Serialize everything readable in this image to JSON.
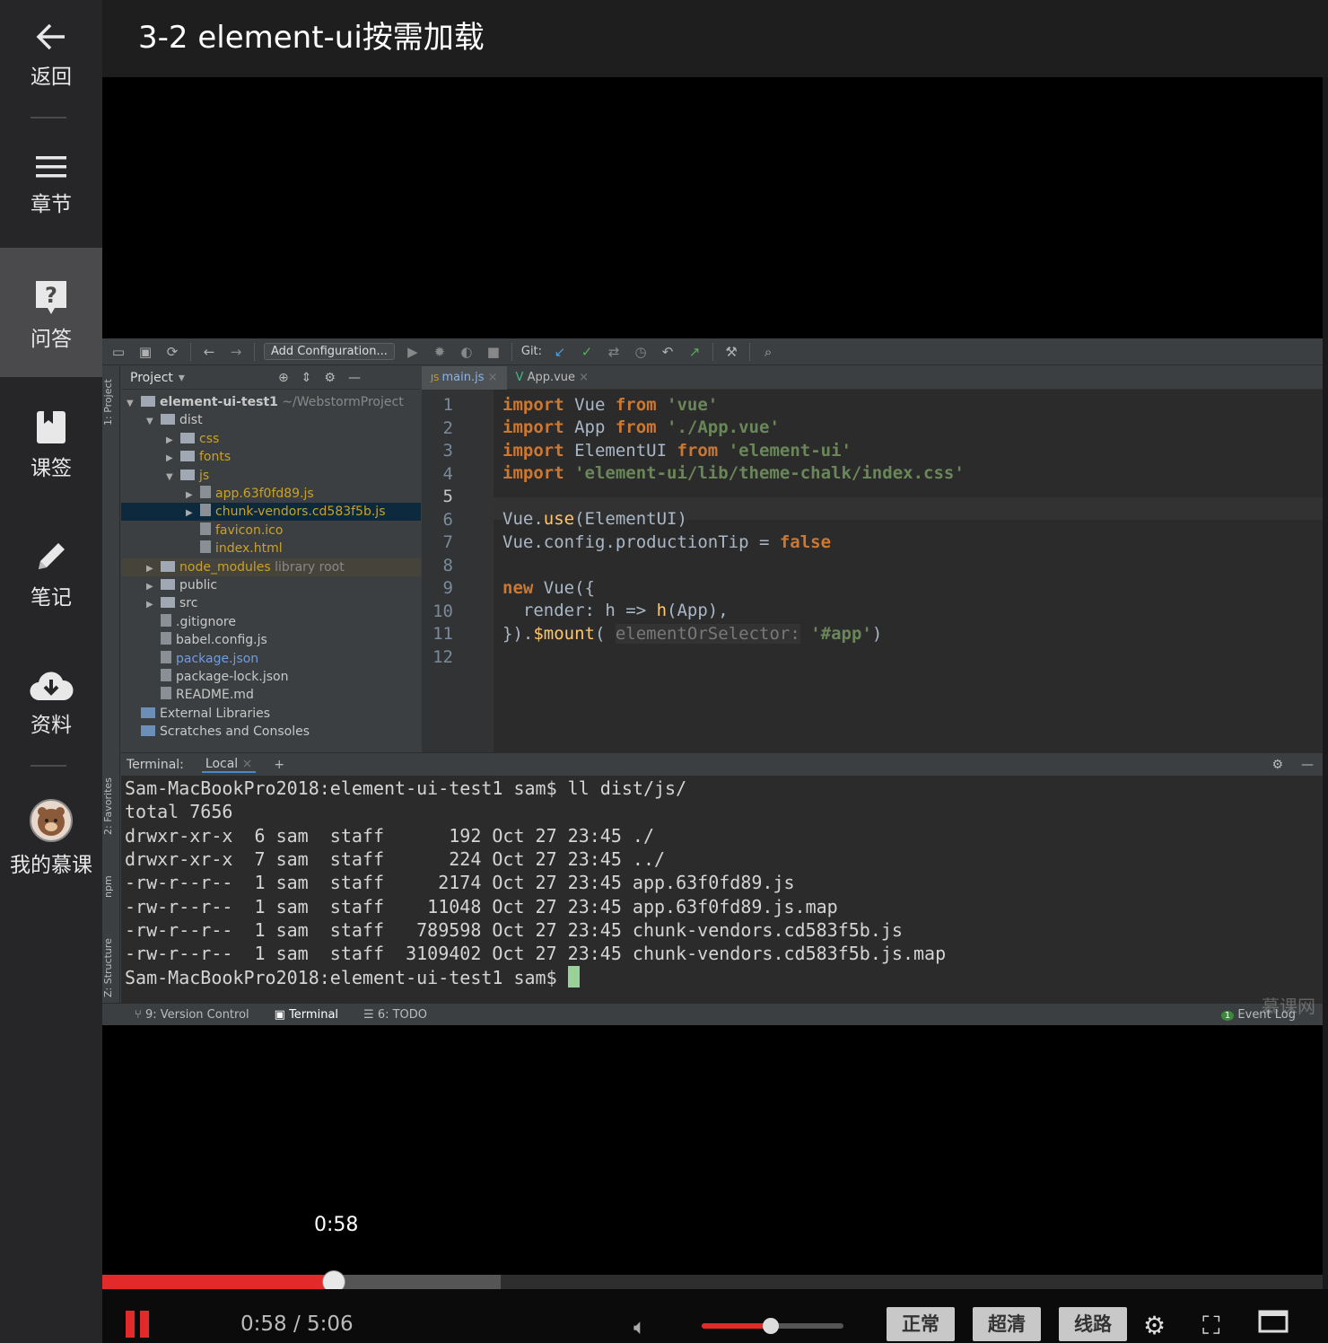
{
  "sidebar": {
    "items": [
      {
        "label": "返回",
        "icon": "back-arrow-icon"
      },
      {
        "label": "章节",
        "icon": "menu-icon"
      },
      {
        "label": "问答",
        "icon": "question-icon"
      },
      {
        "label": "课签",
        "icon": "bookmark-icon"
      },
      {
        "label": "笔记",
        "icon": "pencil-icon"
      },
      {
        "label": "资料",
        "icon": "cloud-download-icon"
      },
      {
        "label": "我的慕课",
        "icon": "avatar"
      }
    ]
  },
  "header": {
    "title": "3-2 element-ui按需加载"
  },
  "ide": {
    "toolbar": {
      "add_config": "Add Configuration...",
      "git_label": "Git:"
    },
    "vtabs": {
      "project": "1: Project",
      "favorites": "2: Favorites",
      "npm": "npm",
      "structure": "Z: Structure"
    },
    "project": {
      "header": "Project",
      "tree": [
        {
          "name": "element-ui-test1",
          "suffix": " ~/WebstormProject",
          "bold": true
        },
        {
          "name": "dist"
        },
        {
          "name": "css",
          "color": "yellow"
        },
        {
          "name": "fonts",
          "color": "yellow"
        },
        {
          "name": "js",
          "color": "yellow"
        },
        {
          "name": "app.63f0fd89.js",
          "color": "yellow"
        },
        {
          "name": "chunk-vendors.cd583f5b.js",
          "color": "yellow"
        },
        {
          "name": "favicon.ico",
          "color": "yellow"
        },
        {
          "name": "index.html",
          "color": "yellow"
        },
        {
          "name": "node_modules",
          "suffix": "  library root",
          "color": "yellow"
        },
        {
          "name": "public"
        },
        {
          "name": "src"
        },
        {
          "name": ".gitignore"
        },
        {
          "name": "babel.config.js"
        },
        {
          "name": "package.json",
          "color": "blue"
        },
        {
          "name": "package-lock.json"
        },
        {
          "name": "README.md"
        },
        {
          "name": "External Libraries"
        },
        {
          "name": "Scratches and Consoles"
        }
      ]
    },
    "tabs": [
      {
        "label": "main.js"
      },
      {
        "label": "App.vue"
      }
    ],
    "line_numbers": [
      "1",
      "2",
      "3",
      "4",
      "5",
      "6",
      "7",
      "8",
      "9",
      "10",
      "11",
      "12"
    ],
    "code": {
      "l1": {
        "kw": "import",
        "mid": " Vue ",
        "kw2": "from",
        "str": " 'vue'"
      },
      "l2": {
        "kw": "import",
        "mid": " App ",
        "kw2": "from",
        "str": " './App.vue'"
      },
      "l3": {
        "kw": "import",
        "mid": " ElementUI ",
        "kw2": "from",
        "str": " 'element-ui'"
      },
      "l4": {
        "kw": "import",
        "str": " 'element-ui/lib/theme-chalk/index.css'"
      },
      "l6": {
        "a": "Vue.",
        "fn": "use",
        "b": "(ElementUI)"
      },
      "l7": {
        "a": "Vue.config.productionTip = ",
        "kw": "false"
      },
      "l9": {
        "kw": "new",
        "a": " Vue({"
      },
      "l10": {
        "a": "  render: h => ",
        "fn": "h",
        "b": "(App),"
      },
      "l11": {
        "a": "}).",
        "fn": "$mount",
        "b": "( ",
        "hint": "elementOrSelector:",
        "str": " '#app'",
        "c": ")"
      }
    },
    "terminal": {
      "header": "Terminal:",
      "tab": "Local",
      "lines": [
        "Sam-MacBookPro2018:element-ui-test1 sam$ ll dist/js/",
        "total 7656",
        "drwxr-xr-x  6 sam  staff      192 Oct 27 23:45 ./",
        "drwxr-xr-x  7 sam  staff      224 Oct 27 23:45 ../",
        "-rw-r--r--  1 sam  staff     2174 Oct 27 23:45 app.63f0fd89.js",
        "-rw-r--r--  1 sam  staff    11048 Oct 27 23:45 app.63f0fd89.js.map",
        "-rw-r--r--  1 sam  staff   789598 Oct 27 23:45 chunk-vendors.cd583f5b.js",
        "-rw-r--r--  1 sam  staff  3109402 Oct 27 23:45 chunk-vendors.cd583f5b.js.map"
      ],
      "prompt": "Sam-MacBookPro2018:element-ui-test1 sam$ "
    },
    "statusbar": {
      "vc": "9: Version Control",
      "terminal": "Terminal",
      "todo": "6: TODO",
      "event_log": "Event Log",
      "event_count": "1",
      "watermark": "慕课网"
    }
  },
  "player": {
    "time_bubble": "0:58",
    "time_text": "0:58 / 5:06",
    "progress_fraction": 0.1895,
    "buffered_fraction": 0.3265,
    "volume_fraction": 0.49,
    "quality_buttons": [
      "正常",
      "超清",
      "线路"
    ]
  },
  "colors": {
    "accent": "#e22a2a",
    "sidebar_bg": "#262628",
    "active_bg": "#4a4a4c"
  }
}
